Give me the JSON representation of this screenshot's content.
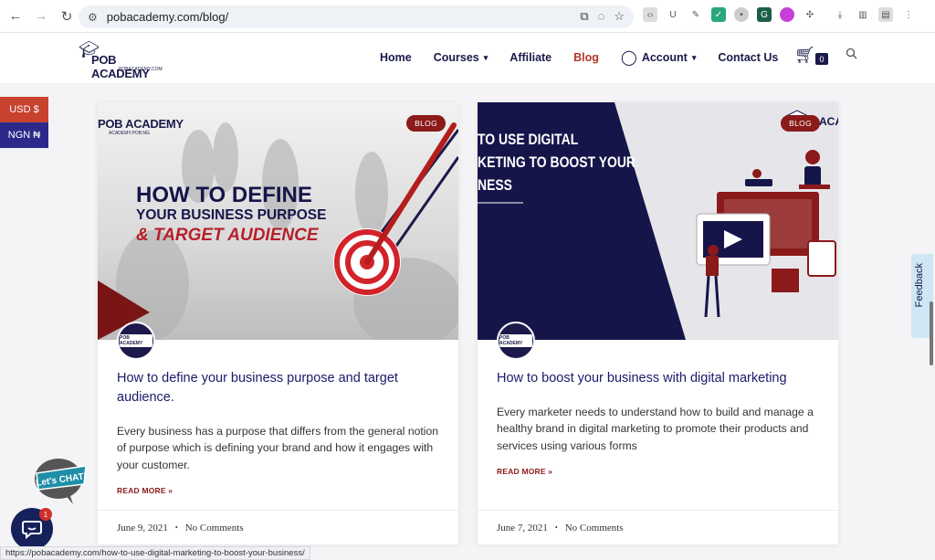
{
  "browser": {
    "url": "pobacademy.com/blog/",
    "status_url": "https://pobacademy.com/how-to-use-digital-marketing-to-boost-your-business/"
  },
  "site": {
    "logo": {
      "name": "POB ACADEMY",
      "sub": "POBACADEMY.COM"
    },
    "nav": [
      {
        "label": "Home"
      },
      {
        "label": "Courses"
      },
      {
        "label": "Affiliate"
      },
      {
        "label": "Blog"
      },
      {
        "label": "Account"
      },
      {
        "label": "Contact Us"
      }
    ],
    "cart_count": "0"
  },
  "currency": {
    "usd": "USD $",
    "ngn": "NGN ₦"
  },
  "posts": [
    {
      "badge": "BLOG",
      "image_text": {
        "brand": "POB ACADEMY",
        "brand_sub": "ACADEMY.POB.NG",
        "line1": "HOW TO DEFINE",
        "line2": "YOUR BUSINESS PURPOSE",
        "line3": "& TARGET AUDIENCE"
      },
      "avatar_text": "POB ACADEMY",
      "title": "How to define your business purpose and target audience.",
      "excerpt": "Every business has a purpose that differs from the general notion of purpose which is defining your brand and how it engages with your customer.",
      "read_more": "READ MORE »",
      "date": "June 9, 2021",
      "comments": "No Comments"
    },
    {
      "badge": "BLOG",
      "image_text": {
        "line1": "TO USE DIGITAL",
        "line2": "KETING TO BOOST YOUR",
        "line3": "NESS",
        "brand": "ACA"
      },
      "avatar_text": "POB ACADEMY",
      "title": "How to boost your business with digital marketing",
      "excerpt": "Every marketer needs to understand how to build and manage a healthy brand in digital marketing to promote their products and services using various forms",
      "read_more": "READ MORE »",
      "date": "June 7, 2021",
      "comments": "No Comments"
    }
  ],
  "feedback_label": "Feedback",
  "chat": {
    "label": "Let's CHAT!",
    "notif_count": "1"
  },
  "colors": {
    "navy": "#1a1a4a",
    "accent": "#b5352a",
    "badge": "#8b1a1a"
  }
}
